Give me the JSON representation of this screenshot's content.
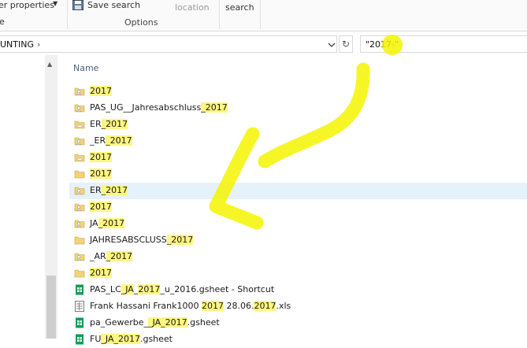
{
  "ribbon": {
    "folder_properties": "er properties",
    "save_search": "Save search",
    "options_group": "Options",
    "open_location": "location",
    "close_search": "search",
    "edge_cut": "e"
  },
  "address": {
    "path": "UNTING",
    "search_value": "\"2017-\""
  },
  "columns": {
    "name": "Name"
  },
  "files": [
    {
      "type": "user-folder",
      "label": "2017",
      "parts": [
        {
          "t": "2017",
          "h": true
        }
      ]
    },
    {
      "type": "user-folder",
      "label": "PAS_UG__Jahresabschluss_2017",
      "parts": [
        {
          "t": "PAS_UG__Jahresabschluss",
          "h": false
        },
        {
          "t": "_2017",
          "h": true
        }
      ]
    },
    {
      "type": "folder-cloud",
      "label": "ER_2017",
      "parts": [
        {
          "t": "ER",
          "h": false
        },
        {
          "t": "_2017",
          "h": true
        }
      ]
    },
    {
      "type": "user-folder",
      "label": "_ER_2017",
      "parts": [
        {
          "t": "_ER",
          "h": false
        },
        {
          "t": "_2017",
          "h": true
        }
      ]
    },
    {
      "type": "folder-cloud",
      "label": "2017",
      "parts": [
        {
          "t": "2017",
          "h": true
        }
      ]
    },
    {
      "type": "folder",
      "label": "2017",
      "parts": [
        {
          "t": "2017",
          "h": true
        }
      ]
    },
    {
      "type": "user-folder",
      "label": "ER_2017",
      "parts": [
        {
          "t": "ER",
          "h": false
        },
        {
          "t": "_2017",
          "h": true
        }
      ],
      "selected": true
    },
    {
      "type": "user-folder",
      "label": "2017",
      "parts": [
        {
          "t": "2017",
          "h": true
        }
      ]
    },
    {
      "type": "user-folder",
      "label": "JA_2017",
      "parts": [
        {
          "t": "JA",
          "h": false
        },
        {
          "t": "_2017",
          "h": true
        }
      ]
    },
    {
      "type": "folder",
      "label": "JAHRESABSCLUSS_2017",
      "parts": [
        {
          "t": "JAHRESABSCLUSS",
          "h": false
        },
        {
          "t": "_2017",
          "h": true
        }
      ]
    },
    {
      "type": "user-folder",
      "label": "_AR_2017",
      "parts": [
        {
          "t": "_AR",
          "h": false
        },
        {
          "t": "_2017",
          "h": true
        }
      ]
    },
    {
      "type": "folder",
      "label": "2017",
      "parts": [
        {
          "t": "2017",
          "h": true
        }
      ]
    },
    {
      "type": "gsheet",
      "label": "PAS_LC_JA_2017_u_2016.gsheet - Shortcut",
      "parts": [
        {
          "t": "PAS_LC",
          "h": false
        },
        {
          "t": "_JA",
          "h": true
        },
        {
          "t": "_",
          "h": false
        },
        {
          "t": "2017",
          "h": true
        },
        {
          "t": "_u_2016.gsheet - Shortcut",
          "h": false
        }
      ]
    },
    {
      "type": "xls",
      "label": "Frank Hassani Frank1000 2017 28.06.2017.xls",
      "parts": [
        {
          "t": "Frank Hassani Frank1000 ",
          "h": false
        },
        {
          "t": "2017",
          "h": true
        },
        {
          "t": " 28.06.",
          "h": false
        },
        {
          "t": "2017",
          "h": true
        },
        {
          "t": ".xls",
          "h": false
        }
      ]
    },
    {
      "type": "gsheet",
      "label": "pa_Gewerbe__JA_2017.gsheet",
      "parts": [
        {
          "t": "pa_Gewerbe_",
          "h": false
        },
        {
          "t": "_JA_2017",
          "h": true
        },
        {
          "t": ".gsheet",
          "h": false
        }
      ]
    },
    {
      "type": "gsheet",
      "label": "FU_JA_2017.gsheet",
      "parts": [
        {
          "t": "FU",
          "h": false
        },
        {
          "t": "_JA_",
          "h": true
        },
        {
          "t": "2017",
          "h": true
        },
        {
          "t": ".gsheet",
          "h": false
        }
      ]
    }
  ],
  "colors": {
    "highlight": "#fff680",
    "annotation": "#f5f500",
    "selected_row": "#e5f1fb",
    "folder": "#f2d27a",
    "gsheet": "#0f9d58"
  },
  "icons": {
    "save": "save-icon",
    "dropdown": "chevron-down-icon",
    "refresh": "refresh-icon",
    "user_folder": "user-folder-icon",
    "folder": "folder-icon",
    "gsheet": "gsheet-icon",
    "xls": "xls-icon"
  }
}
